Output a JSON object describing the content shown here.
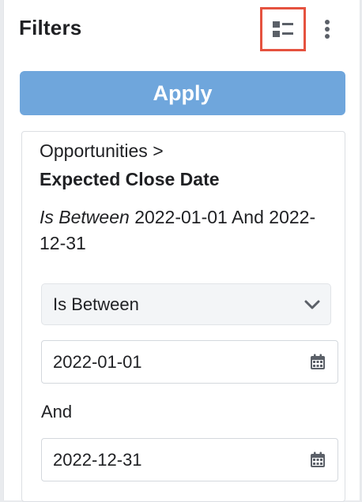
{
  "header": {
    "title": "Filters",
    "summary_toggle_icon": "summary-view-icon",
    "actions_icon": "vertical-ellipsis-icon",
    "highlight_color": "#e5523f"
  },
  "apply_button": {
    "label": "Apply",
    "color": "#6fa6dc"
  },
  "filter": {
    "module": "Opportunities >",
    "field": "Expected Close Date",
    "description_operator": "Is Between",
    "description_value": "2022-01-01 And 2022-12-31",
    "operator_value": "Is Between",
    "start_date": "2022-01-01",
    "conjunction": "And",
    "end_date": "2022-12-31",
    "dropdown_icon": "chevron-down-icon",
    "date_icon": "calendar-icon"
  }
}
